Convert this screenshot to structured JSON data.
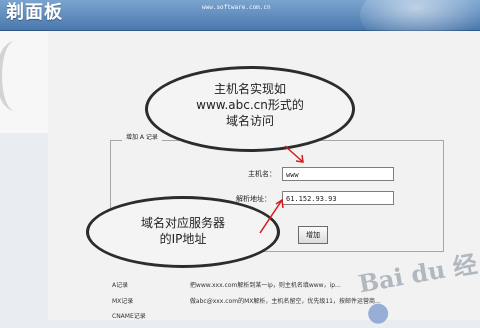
{
  "header": {
    "title": "剃面板",
    "url": "www.software.com.cn"
  },
  "group": {
    "title": "增加 A 记录"
  },
  "form": {
    "host_label": "主机名：",
    "host_value": "www",
    "ip_label": "解析地址：",
    "ip_value": "61.152.93.93",
    "submit": "增加"
  },
  "bubbles": {
    "top": {
      "line1": "主机名实现如",
      "line2": "www.abc.cn形式的",
      "line3": "域名访问"
    },
    "bottom": {
      "line1": "域名对应服务器",
      "line2": "的IP地址"
    }
  },
  "info_rows": [
    {
      "name": "A记录",
      "desc": "把www.xxx.com解析到某一ip，则主机名填www，ip..."
    },
    {
      "name": "MX记录",
      "desc": "做abc@xxx.com的MX解析，主机名留空，优先级11，按邮件运营商..."
    },
    {
      "name": "CNAME记录",
      "desc": ""
    }
  ],
  "watermark": {
    "text": "Bai du 经"
  }
}
